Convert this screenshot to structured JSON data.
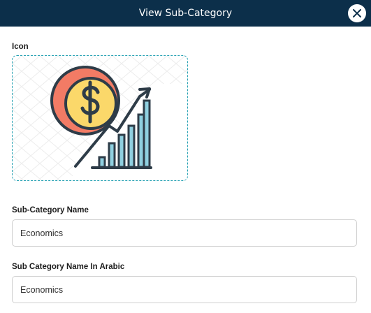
{
  "header": {
    "title": "View Sub-Category"
  },
  "icon_section": {
    "label": "Icon",
    "image_icon": "economy-growth-icon"
  },
  "subcategory_name": {
    "label": "Sub-Category Name",
    "value": "Economics"
  },
  "subcategory_name_arabic": {
    "label": "Sub Category Name In Arabic",
    "value": "Economics"
  },
  "colors": {
    "header_bg": "#0c2f4a",
    "dashed_border": "#2aa3b4"
  }
}
